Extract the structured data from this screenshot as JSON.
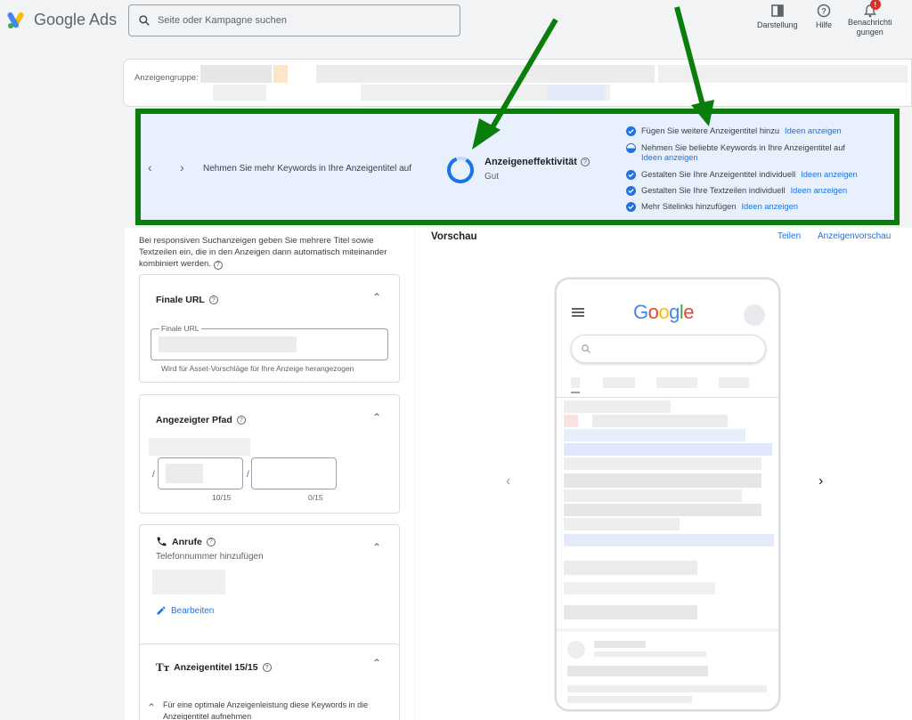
{
  "app": {
    "name": "Google Ads"
  },
  "search": {
    "placeholder": "Seite oder Kampagne suchen"
  },
  "toolbar": {
    "darstellung": "Darstellung",
    "hilfe": "Hilfe",
    "benachrichtigungen_line1": "Benachrichti",
    "benachrichtigungen_line2": "gungen",
    "notification_badge": "!"
  },
  "adgroup": {
    "label": "Anzeigengruppe:"
  },
  "effectiveness": {
    "message": "Nehmen Sie mehr Keywords in Ihre Anzeigentitel auf",
    "title": "Anzeigeneffektivität",
    "status": "Gut",
    "tips": [
      {
        "text": "Fügen Sie weitere Anzeigentitel hinzu",
        "link": "Ideen anzeigen",
        "state": "done"
      },
      {
        "text": "Nehmen Sie beliebte Keywords in Ihre Anzeigentitel auf",
        "link": "Ideen anzeigen",
        "state": "partial"
      },
      {
        "text": "Gestalten Sie Ihre Anzeigentitel individuell",
        "link": "Ideen anzeigen",
        "state": "done"
      },
      {
        "text": "Gestalten Sie Ihre Textzeilen individuell",
        "link": "Ideen anzeigen",
        "state": "done"
      },
      {
        "text": "Mehr Sitelinks hinzufügen",
        "link": "Ideen anzeigen",
        "state": "done"
      }
    ]
  },
  "editor": {
    "intro": "Bei responsiven Suchanzeigen geben Sie mehrere Titel sowie Textzeilen ein, die in den Anzeigen dann automatisch miteinander kombiniert werden.",
    "final_url": {
      "title": "Finale URL",
      "field_label": "Finale URL",
      "hint": "Wird für Asset-Vorschläge für Ihre Anzeige herangezogen"
    },
    "path": {
      "title": "Angezeigter Pfad",
      "separator": "/",
      "count1": "10/15",
      "count2": "0/15"
    },
    "calls": {
      "title": "Anrufe",
      "subtitle": "Telefonnummer hinzufügen",
      "edit": "Bearbeiten"
    },
    "headlines": {
      "title": "Anzeigentitel 15/15",
      "hint": "Für eine optimale Anzeigenleistung diese Keywords in die Anzeigentitel aufnehmen"
    }
  },
  "preview": {
    "title": "Vorschau",
    "share": "Teilen",
    "ad_preview": "Anzeigenvorschau",
    "google_logo": "Google"
  },
  "colors": {
    "accent": "#1a73e8",
    "highlight_border": "#0a7d0a",
    "panel_bg": "#e8f0fe"
  }
}
